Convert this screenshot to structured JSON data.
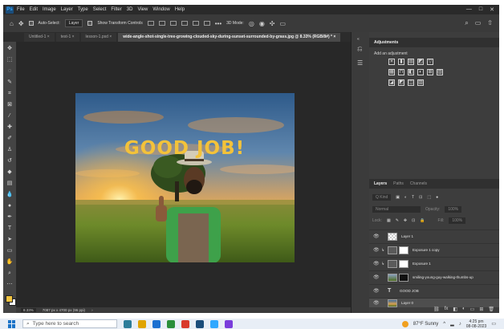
{
  "menubar": {
    "app_logo": "Ps",
    "items": [
      "File",
      "Edit",
      "Image",
      "Layer",
      "Type",
      "Select",
      "Filter",
      "3D",
      "View",
      "Window",
      "Help"
    ],
    "controls": [
      "—",
      "□",
      "✕"
    ]
  },
  "options": {
    "auto_select_label": "Auto-Select:",
    "auto_select_value": "Layer",
    "transform_label": "Show Transform Controls",
    "mode_label": "3D Mode:"
  },
  "tabs": [
    {
      "label": "Untitled-1 ×"
    },
    {
      "label": "test-1 ×"
    },
    {
      "label": "lesson-1.psd ×"
    },
    {
      "label": "wide-angle-shot-single-tree-growing-clouded-sky-during-sunset-surrounded-by-grass.jpg @ 8.33% (RGB/8#) * ×"
    }
  ],
  "canvas": {
    "headline": "GOOD JOB!",
    "colors": {
      "headline": "#f3c23a",
      "sky_top": "#355f8d",
      "sun": "#ffd35a",
      "grass": "#6d8a2a"
    }
  },
  "status": {
    "zoom": "8.33%",
    "doc_info": "7087 px x 4700 px (96 ppi)"
  },
  "adjustments": {
    "tab_label": "Adjustments",
    "subtitle": "Add an adjustment",
    "row1": [
      "☀",
      "▮",
      "▤",
      "◩",
      "▽"
    ],
    "row2": [
      "▦",
      "⊓",
      "◧",
      "◐",
      "⊞",
      "▥"
    ],
    "row3": [
      "◪",
      "◩",
      "◫",
      "▨"
    ]
  },
  "layers_panel": {
    "tabs": [
      "Layers",
      "Paths",
      "Channels"
    ],
    "filter_label": "Q Kind",
    "blend_mode": "Normal",
    "opacity_label": "Opacity:",
    "opacity_value": "100%",
    "lock_label": "Lock:",
    "fill_label": "Fill:",
    "fill_value": "100%",
    "layers": [
      {
        "name": "Layer 1",
        "type": "pixel"
      },
      {
        "name": "Exposure 1 copy",
        "type": "adjustment"
      },
      {
        "name": "Exposure 1",
        "type": "adjustment"
      },
      {
        "name": "smiling-young-guy-walking-thumbs-up",
        "type": "smart"
      },
      {
        "name": "GOOD JOB",
        "type": "text"
      },
      {
        "name": "Layer 0",
        "type": "image"
      }
    ],
    "footer_icons": [
      "fx",
      "◧",
      "◐",
      "▭",
      "⊞",
      "🗑"
    ]
  },
  "taskbar": {
    "search_placeholder": "Type here to search",
    "weather": "87°F  Sunny",
    "time": "4:25 pm",
    "date": "08-08-2023",
    "app_colors": [
      "#2d7d9a",
      "#e0a400",
      "#1a6fd1",
      "#2a8f3a",
      "#d93a2c",
      "#1b4d7a",
      "#31a8ff",
      "#7a3ddb"
    ]
  }
}
